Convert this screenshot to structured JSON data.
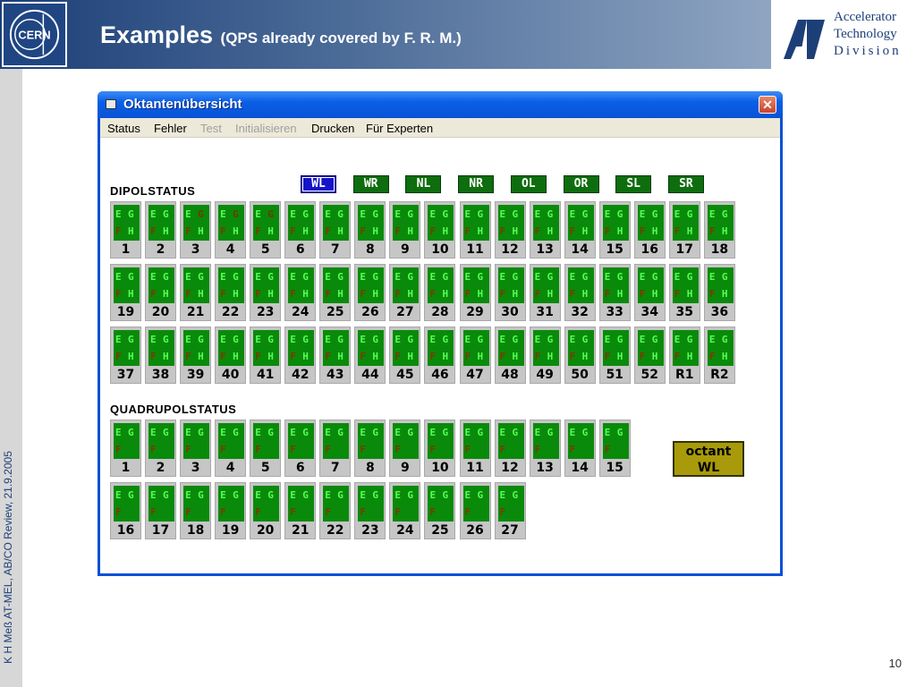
{
  "header": {
    "title": "Examples",
    "subtitle": "(QPS already covered by F. R. M.)",
    "cern_logo_text": "CERN",
    "division": [
      "Accelerator",
      "Technology",
      "Division"
    ]
  },
  "side_text": "K H Meß AT-MEL, AB/CO Review, 21.9.2005",
  "page_number": "10",
  "window": {
    "title": "Oktantenübersicht",
    "close_glyph": "✕",
    "menu": [
      {
        "label": "Status",
        "enabled": true
      },
      {
        "label": "Fehler",
        "enabled": true
      },
      {
        "label": "Test",
        "enabled": false
      },
      {
        "label": "Initialisieren",
        "enabled": false
      },
      {
        "label": "Drucken",
        "enabled": true
      },
      {
        "label": "Für Experten",
        "enabled": true
      }
    ],
    "octant_buttons": [
      {
        "label": "WL",
        "selected": true
      },
      {
        "label": "WR",
        "selected": false
      },
      {
        "label": "NL",
        "selected": false
      },
      {
        "label": "NR",
        "selected": false
      },
      {
        "label": "OL",
        "selected": false
      },
      {
        "label": "OR",
        "selected": false
      },
      {
        "label": "SL",
        "selected": false
      },
      {
        "label": "SR",
        "selected": false
      }
    ],
    "dipol_label": "DIPOLSTATUS",
    "dipol_cells": [
      "1",
      "2",
      "3",
      "4",
      "5",
      "6",
      "7",
      "8",
      "9",
      "10",
      "11",
      "12",
      "13",
      "14",
      "15",
      "16",
      "17",
      "18",
      "19",
      "20",
      "21",
      "22",
      "23",
      "24",
      "25",
      "26",
      "27",
      "28",
      "29",
      "30",
      "31",
      "32",
      "33",
      "34",
      "35",
      "36",
      "37",
      "38",
      "39",
      "40",
      "41",
      "42",
      "43",
      "44",
      "45",
      "46",
      "47",
      "48",
      "49",
      "50",
      "51",
      "52",
      "R1",
      "R2"
    ],
    "dipol_alert_cells": [
      "3",
      "4",
      "5"
    ],
    "quadrupol_label": "QUADRUPOLSTATUS",
    "quadrupol_cells": [
      "1",
      "2",
      "3",
      "4",
      "5",
      "6",
      "7",
      "8",
      "9",
      "10",
      "11",
      "12",
      "13",
      "14",
      "15",
      "16",
      "17",
      "18",
      "19",
      "20",
      "21",
      "22",
      "23",
      "24",
      "25",
      "26",
      "27"
    ],
    "cell_letters": {
      "e": "E",
      "g": "G",
      "f": "F",
      "h": "H"
    },
    "octant_indicator": [
      "octant",
      "WL"
    ],
    "colors": {
      "ok_green": "#0a8a0a",
      "letter_green": "#55ff55",
      "letter_brown": "#7a3a00",
      "selected_blue": "#1414c8",
      "indicator": "#a89a0a"
    }
  }
}
